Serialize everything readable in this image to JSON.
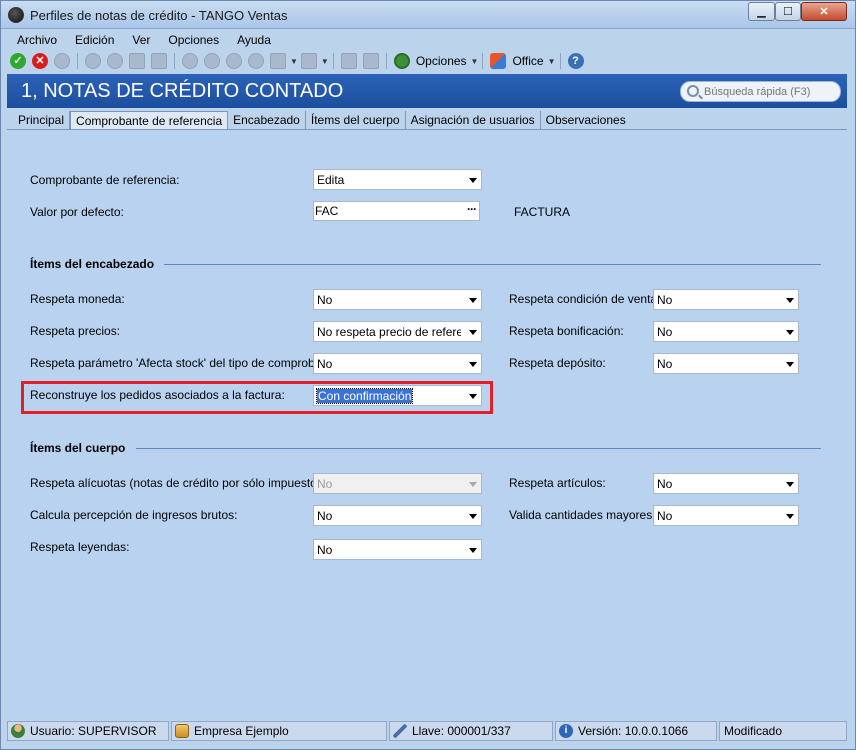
{
  "window": {
    "title": "Perfiles de notas de crédito - TANGO Ventas",
    "min_label": "▁",
    "max_label": "☐",
    "close_label": "✕"
  },
  "menu": [
    "Archivo",
    "Edición",
    "Ver",
    "Opciones",
    "Ayuda"
  ],
  "toolbar": {
    "opciones_label": "Opciones",
    "office_label": "Office"
  },
  "header": {
    "title": "1, NOTAS DE CRÉDITO CONTADO",
    "search_placeholder": "Búsqueda rápida (F3)"
  },
  "tabs": [
    {
      "label": "Principal",
      "active": false
    },
    {
      "label": "Comprobante de referencia",
      "active": true
    },
    {
      "label": "Encabezado",
      "active": false
    },
    {
      "label": "Ítems del cuerpo",
      "active": false
    },
    {
      "label": "Asignación de usuarios",
      "active": false
    },
    {
      "label": "Observaciones",
      "active": false
    }
  ],
  "form": {
    "comprobante_label": "Comprobante de referencia:",
    "comprobante_value": "Edita",
    "valor_label": "Valor por defecto:",
    "valor_value": "FAC",
    "valor_description": "FACTURA",
    "ellipsis": "···",
    "encabezado_title": "Ítems del encabezado",
    "moneda_label": "Respeta moneda:",
    "moneda_value": "No",
    "precios_label": "Respeta precios:",
    "precios_value": "No respeta precio de referencia",
    "stock_label": "Respeta parámetro 'Afecta stock' del tipo de comprobante:",
    "stock_value": "No",
    "reconstruye_label": "Reconstruye los pedidos asociados a la factura:",
    "reconstruye_value": "Con confirmación",
    "condicion_label": "Respeta  condición de venta:",
    "condicion_value": "No",
    "bonificacion_label": "Respeta bonificación:",
    "bonificacion_value": "No",
    "deposito_label": "Respeta depósito:",
    "deposito_value": "No",
    "cuerpo_title": "Ítems del cuerpo",
    "alicuotas_label": "Respeta alícuotas (notas de crédito por sólo impuestos):",
    "alicuotas_value": "No",
    "percepcion_label": "Calcula percepción de ingresos brutos:",
    "percepcion_value": "No",
    "leyendas_label": "Respeta leyendas:",
    "leyendas_value": "No",
    "articulos_label": "Respeta artículos:",
    "articulos_value": "No",
    "cantidades_label": "Valida cantidades mayores:",
    "cantidades_value": "No"
  },
  "status": {
    "usuario": "Usuario: SUPERVISOR",
    "empresa": "Empresa Ejemplo",
    "llave": "Llave: 000001/337",
    "version": "Versión: 10.0.0.1066",
    "estado": "Modificado"
  }
}
